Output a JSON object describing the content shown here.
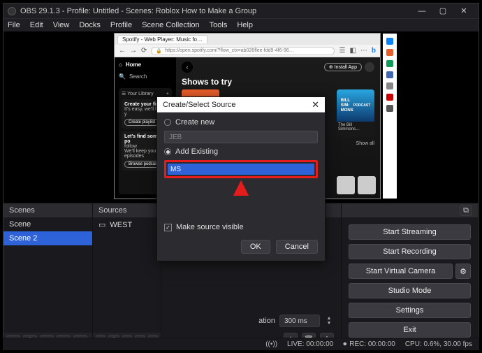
{
  "window": {
    "title": "OBS 29.1.3 - Profile: Untitled - Scenes: Roblox How to Make a Group"
  },
  "menu": [
    "File",
    "Edit",
    "View",
    "Docks",
    "Profile",
    "Scene Collection",
    "Tools",
    "Help"
  ],
  "browser": {
    "tab": "Spotify - Web Player: Music fo…",
    "url": "https://open.spotify.com/?flow_ctx=ab026flee-fdd9-4f6-96…"
  },
  "spotify": {
    "home": "Home",
    "search": "Search",
    "library": "Your Library",
    "card1_title": "Create your first",
    "card1_sub": "It's easy, we'll help y",
    "card1_btn": "Create playlist",
    "card2_title": "Let's find some po",
    "card2_sub1": "follow",
    "card2_sub2": "We'll keep you upd",
    "card2_sub3": "episodes",
    "card2_btn": "Browse podcast",
    "install": "Install App",
    "shows": "Shows to try",
    "showall": "Show all",
    "tile1": "The Bill Simmons…"
  },
  "docks": {
    "scenes_label": "Scenes",
    "sources_label": "Sources",
    "scenes": [
      "Scene",
      "Scene 2"
    ],
    "sources": [
      "WEST"
    ]
  },
  "transition": {
    "label": "ation",
    "value": "300 ms"
  },
  "controls": {
    "stream": "Start Streaming",
    "record": "Start Recording",
    "virtual": "Start Virtual Camera",
    "studio": "Studio Mode",
    "settings": "Settings",
    "exit": "Exit"
  },
  "dialog": {
    "title": "Create/Select Source",
    "create": "Create new",
    "create_value": "JEB",
    "add": "Add Existing",
    "existing_item": "MS",
    "visible": "Make source visible",
    "ok": "OK",
    "cancel": "Cancel"
  },
  "status": {
    "live": "LIVE: 00:00:00",
    "rec": "REC: 00:00:00",
    "cpu": "CPU: 0.6%, 30.00 fps"
  }
}
